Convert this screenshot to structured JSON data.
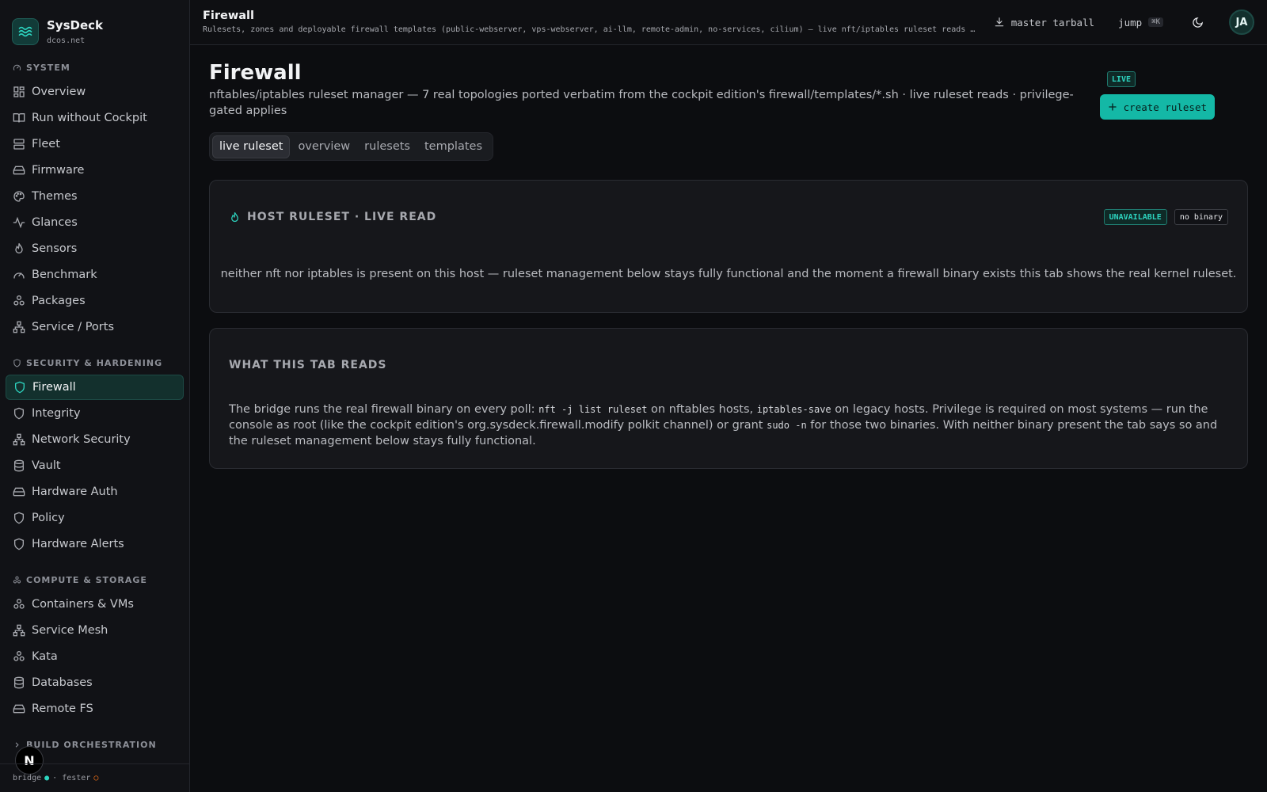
{
  "brand": {
    "name": "SysDeck",
    "domain": "dcos.net"
  },
  "sidebar": {
    "sections": [
      {
        "label": "SYSTEM",
        "items": [
          "Overview",
          "Run without Cockpit",
          "Fleet",
          "Firmware",
          "Themes",
          "Glances",
          "Sensors",
          "Benchmark",
          "Packages",
          "Service / Ports"
        ]
      },
      {
        "label": "SECURITY & HARDENING",
        "items": [
          "Firewall",
          "Integrity",
          "Network Security",
          "Vault",
          "Hardware Auth",
          "Policy",
          "Hardware Alerts"
        ]
      },
      {
        "label": "COMPUTE & STORAGE",
        "items": [
          "Containers & VMs",
          "Service Mesh",
          "Kata",
          "Databases",
          "Remote FS"
        ]
      },
      {
        "label": "BUILD ORCHESTRATION",
        "items": []
      }
    ],
    "active_item": "Firewall",
    "footer": {
      "bridge": "bridge",
      "sep": "·",
      "fester": "fester",
      "bridge_dot": "●",
      "fester_dot": "○"
    },
    "n_badge": "N"
  },
  "topbar": {
    "title": "Firewall",
    "subtitle": "Rulesets, zones and deployable firewall templates (public-webserver, vps-webserver, ai-llm, remote-admin, no-services, cilium) — live nft/iptables ruleset reads and privilege-gated applies",
    "master_tarball": "master tarball",
    "jump": "jump",
    "jump_kbd": "⌘K",
    "avatar": "JA"
  },
  "page": {
    "title": "Firewall",
    "description": "nftables/iptables ruleset manager — 7 real topologies ported verbatim from the cockpit edition's firewall/templates/*.sh · live ruleset reads · privilege-gated applies",
    "live_badge": "LIVE",
    "create_button": "create ruleset",
    "tabs": [
      "live ruleset",
      "overview",
      "rulesets",
      "templates"
    ],
    "active_tab": "live ruleset"
  },
  "card_live": {
    "heading": "HOST RULESET · LIVE READ",
    "badge_status": "UNAVAILABLE",
    "badge_binary": "no binary",
    "message": "neither nft nor iptables is present on this host — ruleset management below stays fully functional and the moment a firewall binary exists this tab shows the real kernel ruleset."
  },
  "card_reads": {
    "heading": "WHAT THIS TAB READS",
    "t1": "The bridge runs the real firewall binary on every poll: ",
    "c1": "nft -j list ruleset",
    "t2": " on nftables hosts, ",
    "c2": "iptables-save",
    "t3": " on legacy hosts. Privilege is required on most systems — run the console as root (like the cockpit edition's org.sysdeck.firewall.modify polkit channel) or grant ",
    "c3": "sudo -n",
    "t4": " for those two binaries. With neither binary present the tab says so and the ruleset management below stays fully functional."
  },
  "colors": {
    "accent": "#14b8a6",
    "accent_text": "#2dd4bf",
    "background": "#0c0d10",
    "sidebar": "#111216",
    "card": "#16171b"
  }
}
